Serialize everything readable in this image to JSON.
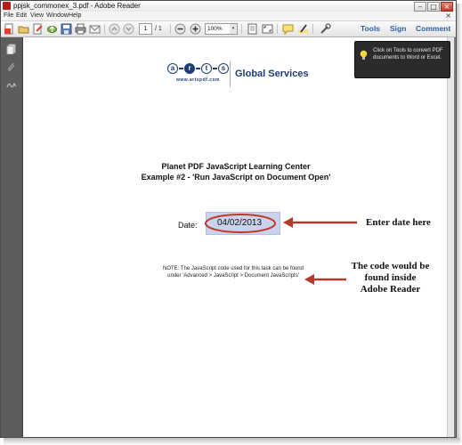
{
  "window": {
    "title": "ppjsk_commonex_3.pdf - Adobe Reader",
    "minimize": "–",
    "maximize": "□",
    "close": "×"
  },
  "menu": {
    "items": [
      "File",
      "Edit",
      "View",
      "Window",
      "Help"
    ],
    "close_doc": "×"
  },
  "toolbar": {
    "page_current": "1",
    "page_total": "/ 1",
    "zoom": "100%",
    "zoom_dropdown": "▾",
    "tabs": [
      "Tools",
      "Sign",
      "Comment"
    ]
  },
  "tooltip": {
    "text": "Click on Tools to convert PDF documents to Word or Excel."
  },
  "document": {
    "logo_letters": [
      "a",
      "r",
      "t",
      "s"
    ],
    "logo_url": "www.artspdf.com",
    "logo_company": "Global Services",
    "title_line1": "Planet PDF JavaScript Learning Center",
    "title_line2": "Example #2 - 'Run JavaScript on Document Open'",
    "date_label": "Date:",
    "date_value": "04/02/2013",
    "note": "NOTE: The JavaScript code used for this task can be found under 'Advanced > JavaScript > Document JavaScripts'"
  },
  "annotations": {
    "date_callout": "Enter date here",
    "code_callout_lines": [
      "The code would be",
      "found inside",
      "Adobe Reader"
    ]
  },
  "colors": {
    "accent_tabs": "#2d5fa6",
    "arrow_red": "#b23a2a",
    "date_field_bg": "#c9d3ec",
    "logo_navy": "#1f3b73"
  }
}
